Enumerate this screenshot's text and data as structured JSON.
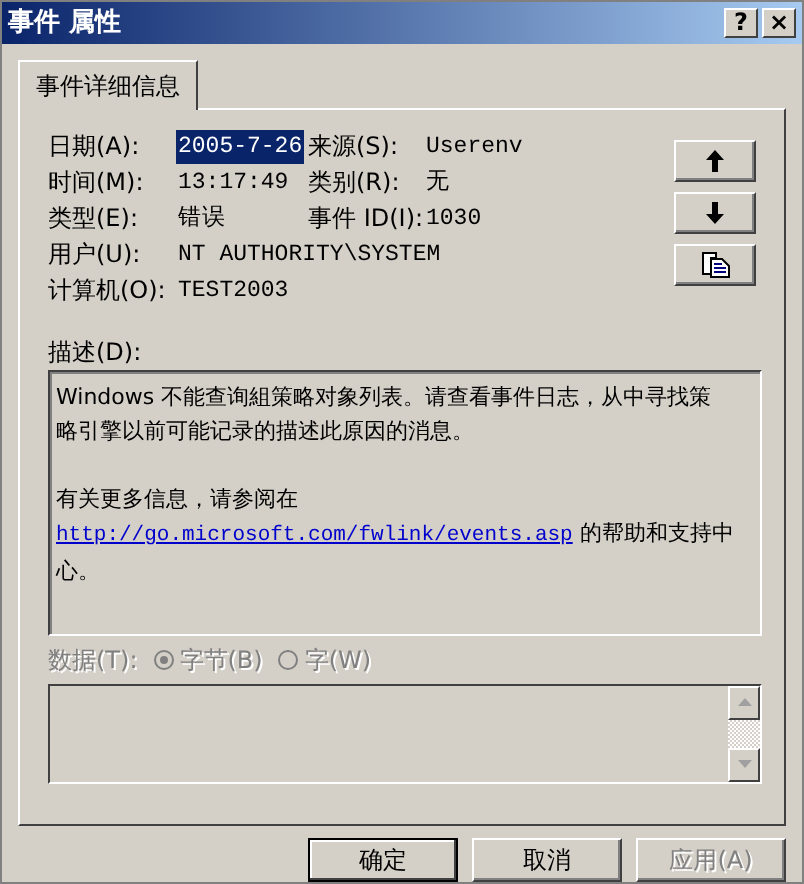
{
  "window": {
    "title": "事件 属性",
    "help": "?",
    "close": "×"
  },
  "tabs": [
    {
      "label": "事件详细信息",
      "selected": true
    }
  ],
  "fields": [
    {
      "label": "日期(A):",
      "value": "2005-7-26",
      "selected": true
    },
    {
      "label": "来源(S):",
      "value": "Userenv",
      "selected": false
    },
    {
      "label": "时间(M):",
      "value": "13:17:49",
      "selected": false
    },
    {
      "label": "类别(R):",
      "value": "无",
      "selected": false
    },
    {
      "label": "类型(E):",
      "value": "错误",
      "selected": false
    },
    {
      "label": "事件 ID(I):",
      "value": "1030",
      "selected": false
    }
  ],
  "user": {
    "label": "用户(U):",
    "value": "NT AUTHORITY\\SYSTEM"
  },
  "computer": {
    "label": "计算机(O):",
    "value": "TEST2003"
  },
  "nav_buttons": [
    {
      "kind": "up"
    },
    {
      "kind": "down"
    },
    {
      "kind": "copy"
    }
  ],
  "description": {
    "label": "描述(D):",
    "lines": [
      [
        {
          "kind": "text",
          "text": "Windows 不能查询組策略对象列表。请查看事件日志，从中寻找策"
        }
      ],
      [
        {
          "kind": "text",
          "text": "略引擎以前可能记录的描述此原因的消息。"
        }
      ],
      [
        {
          "kind": "gap"
        }
      ],
      [
        {
          "kind": "text",
          "text": "有关更多信息，请参阅在"
        }
      ],
      [
        {
          "kind": "link",
          "text": "http://go.microsoft.com/fwlink/events.asp"
        },
        {
          "kind": "text",
          "text": " 的帮助和支持中"
        }
      ],
      [
        {
          "kind": "text",
          "text": "心。"
        }
      ]
    ]
  },
  "data": {
    "label": "数据(T):",
    "disabled": true,
    "options": [
      {
        "label": "字节(B)",
        "selected": true
      },
      {
        "label": "字(W)",
        "selected": false
      }
    ]
  },
  "buttons": [
    {
      "label": "确定",
      "default": true,
      "disabled": false
    },
    {
      "label": "取消",
      "default": false,
      "disabled": false
    },
    {
      "label": "应用(A)",
      "default": false,
      "disabled": true
    }
  ]
}
